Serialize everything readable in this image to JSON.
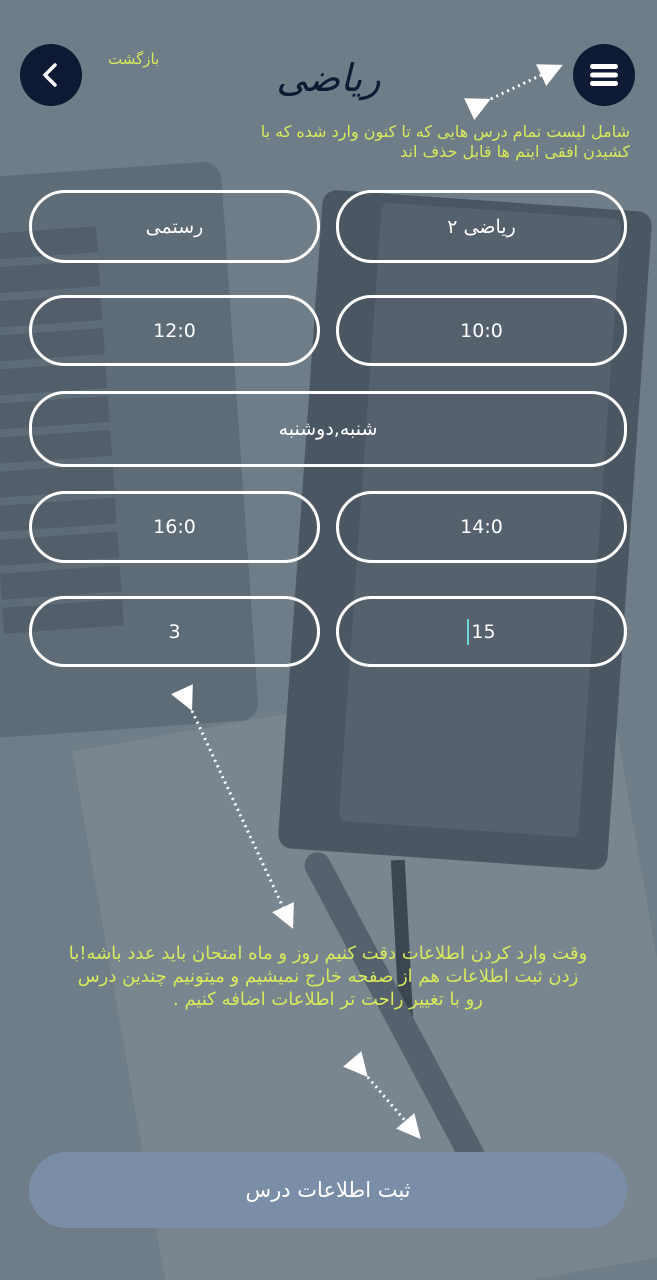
{
  "header": {
    "back_label": "بازگشت",
    "title": "ریاضی",
    "back_icon": "chevron-left-icon",
    "menu_icon": "hamburger-menu-icon"
  },
  "annotations": {
    "top_note": "شامل لیست تمام درس هایی که تا کنون وارد شده که با کشیدن افقی ایتم ها قابل حذف اند",
    "bottom_note": "وقت وارد کردن اطلاعات دقت کنیم روز و ماه امتحان باید عدد باشه!با زدن ثبت اطلاعات هم از صفحه خارج نمیشیم و میتونیم چندین درس رو با تغییر راحت تر اطلاعات اضافه کنیم ."
  },
  "form": {
    "lesson_name": "ریاضی ۲",
    "teacher": "رستمی",
    "start_time": "10:0",
    "end_time": "12:0",
    "days": "شنبه,دوشنبه",
    "exam_start_time": "14:0",
    "exam_end_time": "16:0",
    "exam_day": "15",
    "exam_month": "3"
  },
  "submit_label": "ثبت اطلاعات درس",
  "colors": {
    "accent_text": "#d8ea5c",
    "button_dark": "#0e1a33",
    "submit_bg": "#7a8ea7",
    "field_border": "#ffffff",
    "caret": "#6fd4d4"
  }
}
